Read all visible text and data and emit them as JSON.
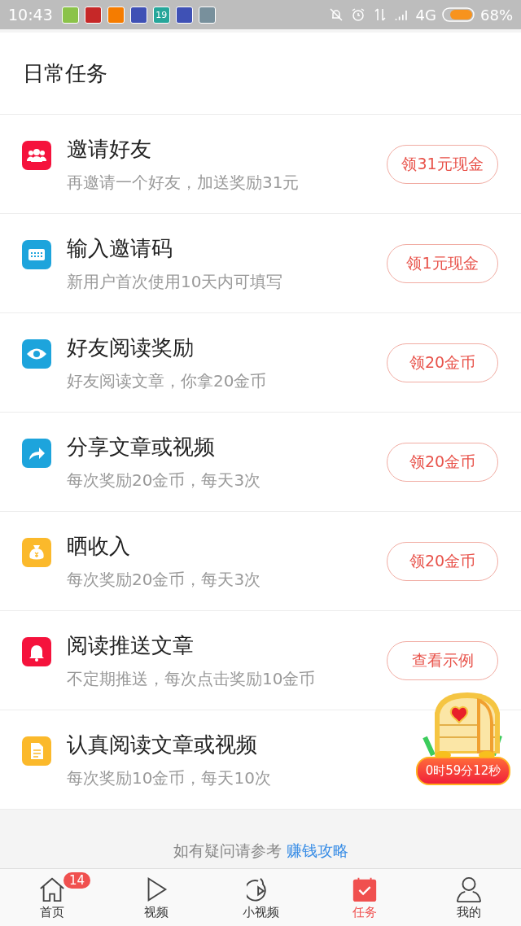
{
  "status_bar": {
    "time": "10:43",
    "notifications": [
      {
        "color": "#8bc34a"
      },
      {
        "color": "#c62828"
      },
      {
        "color": "#f57c00"
      },
      {
        "color": "#3f51b5"
      },
      {
        "color": "#26a69a",
        "text": "19"
      },
      {
        "color": "#3f51b5"
      },
      {
        "color": "#78909c"
      }
    ],
    "network": "4G",
    "battery": "68%"
  },
  "section_title": "日常任务",
  "tasks": [
    {
      "kind": "people",
      "color": "#f5123c",
      "title": "邀请好友",
      "subtitle": "再邀请一个好友，加送奖励31元",
      "button": "领31元现金"
    },
    {
      "kind": "ticket",
      "color": "#1da4dc",
      "title": "输入邀请码",
      "subtitle": "新用户首次使用10天内可填写",
      "button": "领1元现金"
    },
    {
      "kind": "eye",
      "color": "#1da4dc",
      "title": "好友阅读奖励",
      "subtitle": "好友阅读文章，你拿20金币",
      "button": "领20金币"
    },
    {
      "kind": "share",
      "color": "#1da4dc",
      "title": "分享文章或视频",
      "subtitle": "每次奖励20金币，每天3次",
      "button": "领20金币"
    },
    {
      "kind": "moneybag",
      "color": "#fbb92b",
      "title": "晒收入",
      "subtitle": "每次奖励20金币，每天3次",
      "button": "领20金币"
    },
    {
      "kind": "bell",
      "color": "#f5123c",
      "title": "阅读推送文章",
      "subtitle": "不定期推送，每次点击奖励10金币",
      "button": "查看示例"
    },
    {
      "kind": "doc",
      "color": "#fbb92b",
      "title": "认真阅读文章或视频",
      "subtitle": "每次奖励10金币，每天10次"
    }
  ],
  "treasure_timer": "0时59分12秒",
  "help": {
    "text": "如有疑问请参考",
    "link": "赚钱攻略"
  },
  "nav": [
    {
      "kind": "home",
      "label": "首页",
      "badge": "14",
      "selected": false
    },
    {
      "kind": "video",
      "label": "视频",
      "selected": false
    },
    {
      "kind": "short",
      "label": "小视频",
      "selected": false
    },
    {
      "kind": "task",
      "label": "任务",
      "selected": true
    },
    {
      "kind": "me",
      "label": "我的",
      "selected": false
    }
  ]
}
